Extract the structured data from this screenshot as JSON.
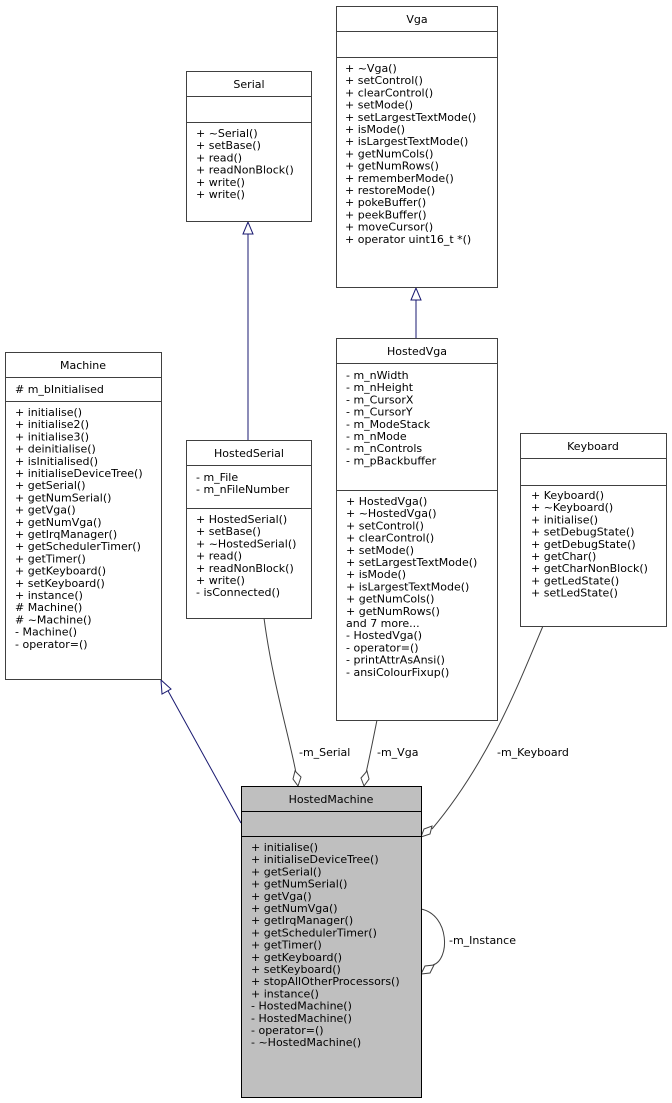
{
  "diagram": {
    "type": "uml-class-collaboration",
    "classes": {
      "vga": {
        "name": "Vga",
        "attributes": [],
        "methods": [
          "+ ~Vga()",
          "+ setControl()",
          "+ clearControl()",
          "+ setMode()",
          "+ setLargestTextMode()",
          "+ isMode()",
          "+ isLargestTextMode()",
          "+ getNumCols()",
          "+ getNumRows()",
          "+ rememberMode()",
          "+ restoreMode()",
          "+ pokeBuffer()",
          "+ peekBuffer()",
          "+ moveCursor()",
          "+ operator uint16_t *()"
        ]
      },
      "serial": {
        "name": "Serial",
        "attributes": [],
        "methods": [
          "+ ~Serial()",
          "+ setBase()",
          "+ read()",
          "+ readNonBlock()",
          "+ write()",
          "+ write()"
        ]
      },
      "machine": {
        "name": "Machine",
        "attributes": [
          "# m_bInitialised"
        ],
        "methods": [
          "+ initialise()",
          "+ initialise2()",
          "+ initialise3()",
          "+ deinitialise()",
          "+ isInitialised()",
          "+ initialiseDeviceTree()",
          "+ getSerial()",
          "+ getNumSerial()",
          "+ getVga()",
          "+ getNumVga()",
          "+ getIrqManager()",
          "+ getSchedulerTimer()",
          "+ getTimer()",
          "+ getKeyboard()",
          "+ setKeyboard()",
          "+ instance()",
          "# Machine()",
          "# ~Machine()",
          "- Machine()",
          "- operator=()"
        ]
      },
      "hosted_serial": {
        "name": "HostedSerial",
        "attributes": [
          "- m_File",
          "- m_nFileNumber"
        ],
        "methods": [
          "+ HostedSerial()",
          "+ setBase()",
          "+ ~HostedSerial()",
          "+ read()",
          "+ readNonBlock()",
          "+ write()",
          "- isConnected()"
        ]
      },
      "hosted_vga": {
        "name": "HostedVga",
        "attributes": [
          "- m_nWidth",
          "- m_nHeight",
          "- m_CursorX",
          "- m_CursorY",
          "- m_ModeStack",
          "- m_nMode",
          "- m_nControls",
          "- m_pBackbuffer"
        ],
        "methods": [
          "+ HostedVga()",
          "+ ~HostedVga()",
          "+ setControl()",
          "+ clearControl()",
          "+ setMode()",
          "+ setLargestTextMode()",
          "+ isMode()",
          "+ isLargestTextMode()",
          "+ getNumCols()",
          "+ getNumRows()",
          "and 7 more...",
          "- HostedVga()",
          "- operator=()",
          "- printAttrAsAnsi()",
          "- ansiColourFixup()"
        ]
      },
      "keyboard": {
        "name": "Keyboard",
        "attributes": [],
        "methods": [
          "+ Keyboard()",
          "+ ~Keyboard()",
          "+ initialise()",
          "+ setDebugState()",
          "+ getDebugState()",
          "+ getChar()",
          "+ getCharNonBlock()",
          "+ getLedState()",
          "+ setLedState()"
        ]
      },
      "hosted_machine": {
        "name": "HostedMachine",
        "attributes": [],
        "methods": [
          "+ initialise()",
          "+ initialiseDeviceTree()",
          "+ getSerial()",
          "+ getNumSerial()",
          "+ getVga()",
          "+ getNumVga()",
          "+ getIrqManager()",
          "+ getSchedulerTimer()",
          "+ getTimer()",
          "+ getKeyboard()",
          "+ setKeyboard()",
          "+ stopAllOtherProcessors()",
          "+ instance()",
          "- HostedMachine()",
          "- HostedMachine()",
          "- operator=()",
          "- ~HostedMachine()"
        ]
      }
    },
    "relations": {
      "serial_to_hosted_serial": {
        "kind": "inheritance",
        "from": "HostedSerial",
        "to": "Serial"
      },
      "vga_to_hosted_vga": {
        "kind": "inheritance",
        "from": "HostedVga",
        "to": "Vga"
      },
      "machine_to_hosted_machine": {
        "kind": "inheritance",
        "from": "HostedMachine",
        "to": "Machine"
      },
      "m_serial": {
        "kind": "aggregation",
        "from": "HostedSerial",
        "to": "HostedMachine",
        "label": "-m_Serial"
      },
      "m_vga": {
        "kind": "aggregation",
        "from": "HostedVga",
        "to": "HostedMachine",
        "label": "-m_Vga"
      },
      "m_keyboard": {
        "kind": "aggregation",
        "from": "Keyboard",
        "to": "HostedMachine",
        "label": "-m_Keyboard"
      },
      "m_instance": {
        "kind": "aggregation",
        "from": "HostedMachine",
        "to": "HostedMachine",
        "label": "-m_Instance"
      }
    },
    "colors": {
      "focus_fill": "#bfbfbf",
      "inheritance_edge": "#191970",
      "aggregation_edge": "#404040"
    }
  }
}
